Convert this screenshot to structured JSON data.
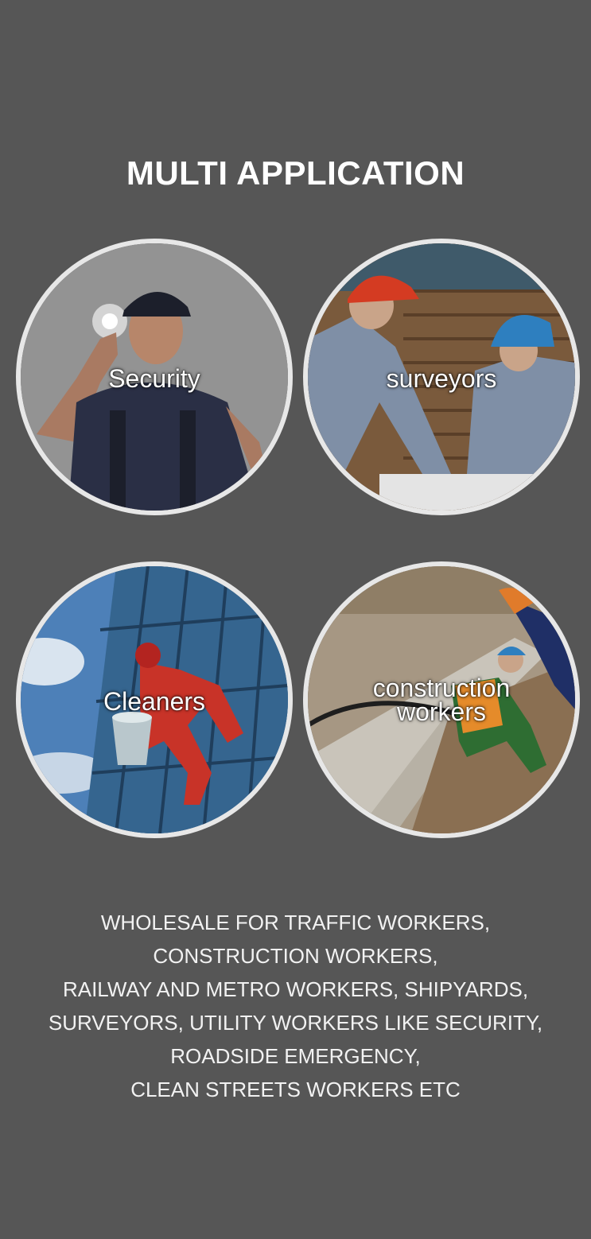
{
  "page": {
    "background": "#565656",
    "title": "MULTI APPLICATION"
  },
  "applications": [
    {
      "label": "Security",
      "scene": "security-guard-photo"
    },
    {
      "label": "surveyors",
      "scene": "surveyors-photo"
    },
    {
      "label": "Cleaners",
      "scene": "window-cleaner-photo"
    },
    {
      "label_line1": "construction",
      "label_line2": "workers",
      "scene": "construction-workers-photo"
    }
  ],
  "description": {
    "lines": [
      "WHOLESALE FOR TRAFFIC WORKERS,",
      "CONSTRUCTION WORKERS,",
      "RAILWAY AND METRO WORKERS, SHIPYARDS,",
      "SURVEYORS, UTILITY WORKERS LIKE SECURITY,",
      "ROADSIDE EMERGENCY,",
      "CLEAN STREETS WORKERS ETC"
    ]
  },
  "colors": {
    "circle_border": "#e7e7e7",
    "text": "#ffffff"
  }
}
